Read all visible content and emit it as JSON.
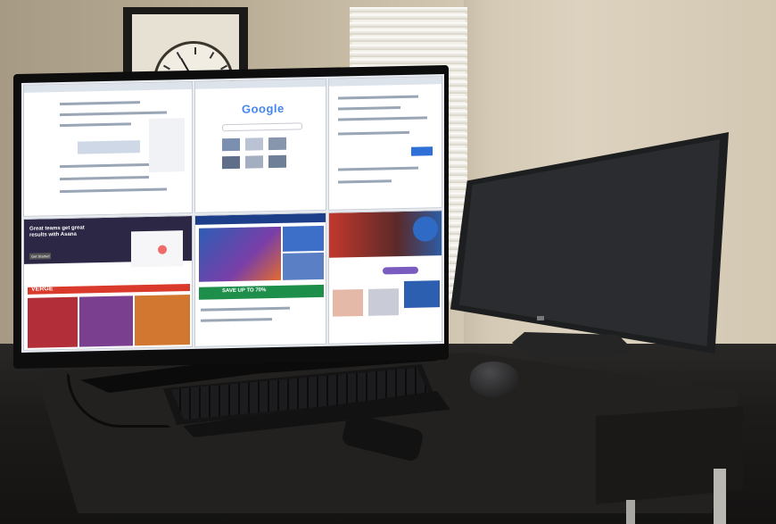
{
  "scene": {
    "description_visible_text": {
      "google_logo": "Google",
      "asana_headline": "Great teams get great results with Asana",
      "asana_button": "Get Started",
      "news_banner": "VERGE",
      "save_banner": "SAVE UP TO 70%"
    }
  },
  "colors": {
    "google_blue": "#4285f4",
    "google_red": "#ea4335",
    "google_yellow": "#fbbc05",
    "google_green": "#34a853",
    "asana_bg": "#2d2746",
    "asana_accent": "#f06a6a",
    "site_red": "#d93a2b",
    "tech_blue": "#1d3f8a"
  },
  "icons": [
    "monitor-main",
    "monitor-side",
    "keyboard",
    "mouse",
    "remote",
    "clock",
    "window-blinds"
  ]
}
